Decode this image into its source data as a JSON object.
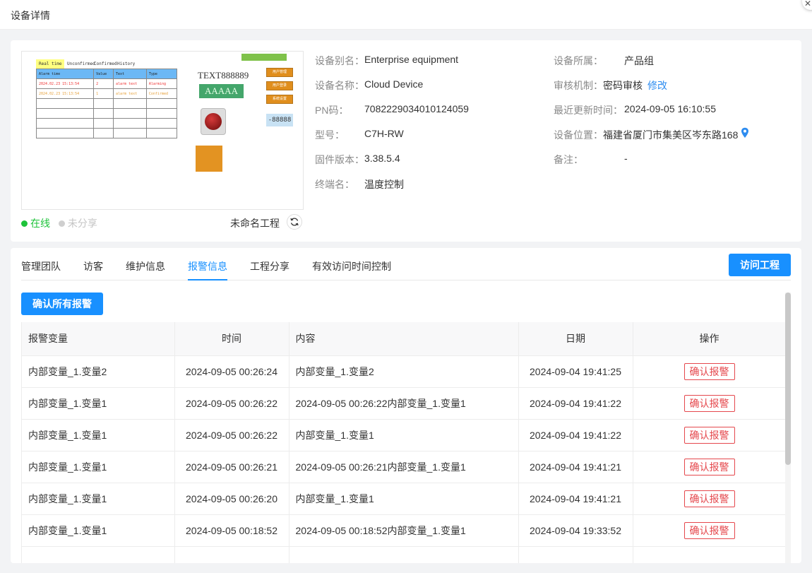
{
  "dialog": {
    "title": "设备详情"
  },
  "preview": {
    "tabs": [
      "Real time",
      "Unconfirmed",
      "Confirmed",
      "History"
    ],
    "table_headers": [
      "Alarm time",
      "Value",
      "Text",
      "Type"
    ],
    "rows": [
      [
        "2024.02.23 15:13:54",
        "2",
        "alarm text",
        "Alarming"
      ],
      [
        "2024.02.23 15:13:54",
        "1",
        "alarm text",
        "Confirmed"
      ]
    ],
    "text_label": "TEXT888889",
    "green_box": "AAAAA",
    "buttons": [
      "用户管理",
      "用户登录",
      "系统设置"
    ],
    "number": "-88888"
  },
  "status": {
    "online": "在线",
    "unshared": "未分享",
    "online_color": "#1ec33a"
  },
  "project": {
    "name": "未命名工程"
  },
  "info": {
    "alias_label": "设备别名：",
    "alias": "Enterprise equipment",
    "name_label": "设备名称：",
    "name": "Cloud Device",
    "pn_label": "PN码：",
    "pn": "7082229034010124059",
    "model_label": "型号：",
    "model": "C7H-RW",
    "firmware_label": "固件版本：",
    "firmware": "3.38.5.4",
    "terminal_label": "终端名：",
    "terminal": "温度控制",
    "group_label": "设备所属：",
    "group": "产品组",
    "audit_label": "审核机制：",
    "audit": "密码审核",
    "audit_link": "修改",
    "updated_label": "最近更新时间：",
    "updated": "2024-09-05 16:10:55",
    "location_label": "设备位置：",
    "location": "福建省厦门市集美区岑东路168",
    "note_label": "备注：",
    "note": "-"
  },
  "tabs": [
    "管理团队",
    "访客",
    "维护信息",
    "报警信息",
    "工程分享",
    "有效访问时间控制"
  ],
  "active_tab": "报警信息",
  "visit_button": "访问工程",
  "confirm_all_button": "确认所有报警",
  "table": {
    "headers": [
      "报警变量",
      "时间",
      "内容",
      "日期",
      "操作"
    ],
    "action_label": "确认报警",
    "rows": [
      [
        "内部变量_1.变量2",
        "2024-09-05 00:26:24",
        "内部变量_1.变量2",
        "2024-09-04 19:41:25"
      ],
      [
        "内部变量_1.变量1",
        "2024-09-05 00:26:22",
        "2024-09-05 00:26:22内部变量_1.变量1",
        "2024-09-04 19:41:22"
      ],
      [
        "内部变量_1.变量1",
        "2024-09-05 00:26:22",
        "内部变量_1.变量1",
        "2024-09-04 19:41:22"
      ],
      [
        "内部变量_1.变量1",
        "2024-09-05 00:26:21",
        "2024-09-05 00:26:21内部变量_1.变量1",
        "2024-09-04 19:41:21"
      ],
      [
        "内部变量_1.变量1",
        "2024-09-05 00:26:20",
        "内部变量_1.变量1",
        "2024-09-04 19:41:21"
      ],
      [
        "内部变量_1.变量1",
        "2024-09-05 00:18:52",
        "2024-09-05 00:18:52内部变量_1.变量1",
        "2024-09-04 19:33:52"
      ]
    ]
  }
}
